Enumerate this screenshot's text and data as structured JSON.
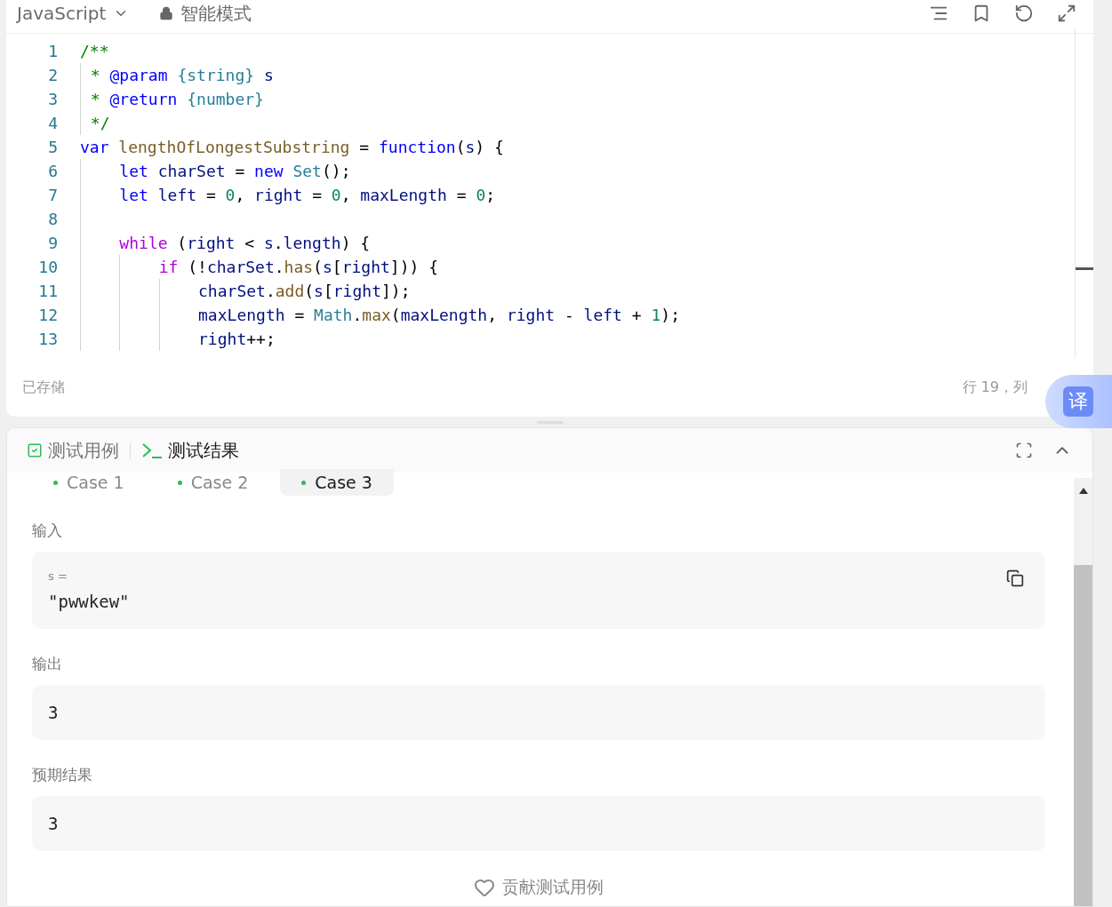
{
  "editor": {
    "language": "JavaScript",
    "mode": "智能模式",
    "lines": [
      {
        "number": "1",
        "tokens": [
          {
            "kind": "comment",
            "text": "/**"
          }
        ]
      },
      {
        "number": "2",
        "tokens": [
          {
            "kind": "comment",
            "text": " * "
          },
          {
            "kind": "doctag",
            "text": "@param "
          },
          {
            "kind": "type",
            "text": "{string} "
          },
          {
            "kind": "variable",
            "text": "s"
          }
        ]
      },
      {
        "number": "3",
        "tokens": [
          {
            "kind": "comment",
            "text": " * "
          },
          {
            "kind": "doctag",
            "text": "@return "
          },
          {
            "kind": "type",
            "text": "{number}"
          }
        ]
      },
      {
        "number": "4",
        "tokens": [
          {
            "kind": "comment",
            "text": " */"
          }
        ]
      },
      {
        "number": "5",
        "tokens": [
          {
            "kind": "keyword",
            "text": "var "
          },
          {
            "kind": "function",
            "text": "lengthOfLongestSubstring"
          },
          {
            "kind": "plain",
            "text": " = "
          },
          {
            "kind": "keyword",
            "text": "function"
          },
          {
            "kind": "plain",
            "text": "("
          },
          {
            "kind": "variable",
            "text": "s"
          },
          {
            "kind": "plain",
            "text": ") {"
          }
        ]
      },
      {
        "number": "6",
        "tokens": [
          {
            "kind": "keyword",
            "text": "    let "
          },
          {
            "kind": "variable",
            "text": "charSet"
          },
          {
            "kind": "plain",
            "text": " = "
          },
          {
            "kind": "keyword",
            "text": "new "
          },
          {
            "kind": "class",
            "text": "Set"
          },
          {
            "kind": "plain",
            "text": "();"
          }
        ]
      },
      {
        "number": "7",
        "tokens": [
          {
            "kind": "keyword",
            "text": "    let "
          },
          {
            "kind": "variable",
            "text": "left"
          },
          {
            "kind": "plain",
            "text": " = "
          },
          {
            "kind": "number",
            "text": "0"
          },
          {
            "kind": "plain",
            "text": ", "
          },
          {
            "kind": "variable",
            "text": "right"
          },
          {
            "kind": "plain",
            "text": " = "
          },
          {
            "kind": "number",
            "text": "0"
          },
          {
            "kind": "plain",
            "text": ", "
          },
          {
            "kind": "variable",
            "text": "maxLength"
          },
          {
            "kind": "plain",
            "text": " = "
          },
          {
            "kind": "number",
            "text": "0"
          },
          {
            "kind": "plain",
            "text": ";"
          }
        ]
      },
      {
        "number": "8"
      },
      {
        "number": "9",
        "tokens": [
          {
            "kind": "control",
            "text": "    while"
          },
          {
            "kind": "plain",
            "text": " ("
          },
          {
            "kind": "variable",
            "text": "right"
          },
          {
            "kind": "plain",
            "text": " < "
          },
          {
            "kind": "variable",
            "text": "s"
          },
          {
            "kind": "plain",
            "text": "."
          },
          {
            "kind": "variable",
            "text": "length"
          },
          {
            "kind": "plain",
            "text": ") {"
          }
        ]
      },
      {
        "number": "10",
        "tokens": [
          {
            "kind": "control",
            "text": "        if"
          },
          {
            "kind": "plain",
            "text": " (!"
          },
          {
            "kind": "variable",
            "text": "charSet"
          },
          {
            "kind": "plain",
            "text": "."
          },
          {
            "kind": "function",
            "text": "has"
          },
          {
            "kind": "plain",
            "text": "("
          },
          {
            "kind": "variable",
            "text": "s"
          },
          {
            "kind": "plain",
            "text": "["
          },
          {
            "kind": "variable",
            "text": "right"
          },
          {
            "kind": "plain",
            "text": "])) {"
          }
        ]
      },
      {
        "number": "11",
        "tokens": [
          {
            "kind": "variable",
            "text": "            charSet"
          },
          {
            "kind": "plain",
            "text": "."
          },
          {
            "kind": "function",
            "text": "add"
          },
          {
            "kind": "plain",
            "text": "("
          },
          {
            "kind": "variable",
            "text": "s"
          },
          {
            "kind": "plain",
            "text": "["
          },
          {
            "kind": "variable",
            "text": "right"
          },
          {
            "kind": "plain",
            "text": "]);"
          }
        ]
      },
      {
        "number": "12",
        "tokens": [
          {
            "kind": "variable",
            "text": "            maxLength"
          },
          {
            "kind": "plain",
            "text": " = "
          },
          {
            "kind": "class",
            "text": "Math"
          },
          {
            "kind": "plain",
            "text": "."
          },
          {
            "kind": "function",
            "text": "max"
          },
          {
            "kind": "plain",
            "text": "("
          },
          {
            "kind": "variable",
            "text": "maxLength"
          },
          {
            "kind": "plain",
            "text": ", "
          },
          {
            "kind": "variable",
            "text": "right"
          },
          {
            "kind": "plain",
            "text": " - "
          },
          {
            "kind": "variable",
            "text": "left"
          },
          {
            "kind": "plain",
            "text": " + "
          },
          {
            "kind": "number",
            "text": "1"
          },
          {
            "kind": "plain",
            "text": ");"
          }
        ]
      },
      {
        "number": "13",
        "tokens": [
          {
            "kind": "variable",
            "text": "            right"
          },
          {
            "kind": "plain",
            "text": "++;"
          }
        ]
      }
    ],
    "saved_status": "已存储",
    "cursor_position": "行 19，列"
  },
  "translate_button": {
    "label": "译"
  },
  "tests": {
    "tabs": [
      {
        "label": "测试用例",
        "selected": false
      },
      {
        "label": "测试结果",
        "selected": true
      }
    ],
    "cases": [
      {
        "label": "Case 1",
        "selected": false
      },
      {
        "label": "Case 2",
        "selected": false
      },
      {
        "label": "Case 3",
        "selected": true
      }
    ],
    "input": {
      "label": "输入",
      "variable": "s =",
      "value": "\"pwwkew\""
    },
    "output": {
      "label": "输出",
      "value": "3"
    },
    "expected": {
      "label": "预期结果",
      "value": "3"
    },
    "contribute": "贡献测试用例"
  }
}
